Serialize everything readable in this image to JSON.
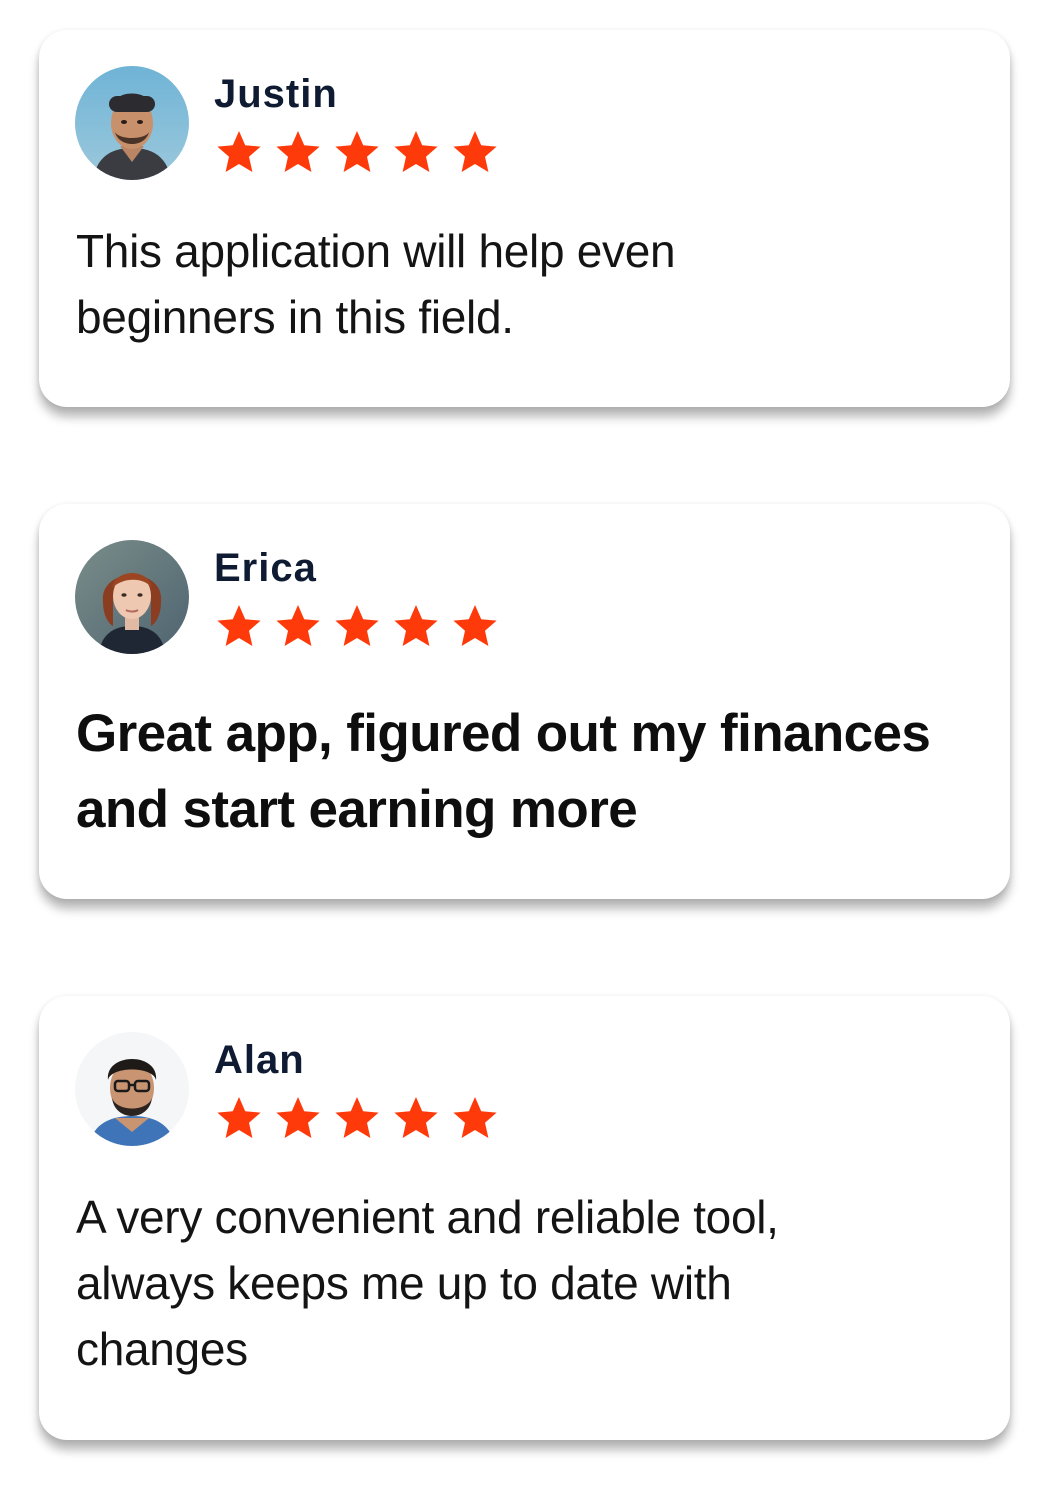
{
  "theme": {
    "star_color": "#ff3a0a",
    "name_color": "#0f1b33",
    "text_color": "#141414",
    "card_background": "#ffffff"
  },
  "reviews": [
    {
      "name": "Justin",
      "rating": 5,
      "text": "This application will help even beginners in this field.",
      "avatar_icon": "avatar-photo-man-beanie"
    },
    {
      "name": "Erica",
      "rating": 5,
      "text": "Great app, figured out my finances and start earning more",
      "avatar_icon": "avatar-photo-woman-red-hair"
    },
    {
      "name": "Alan",
      "rating": 5,
      "text": "A very convenient and reliable tool, always keeps me up to date with changes",
      "avatar_icon": "avatar-photo-man-glasses"
    }
  ]
}
